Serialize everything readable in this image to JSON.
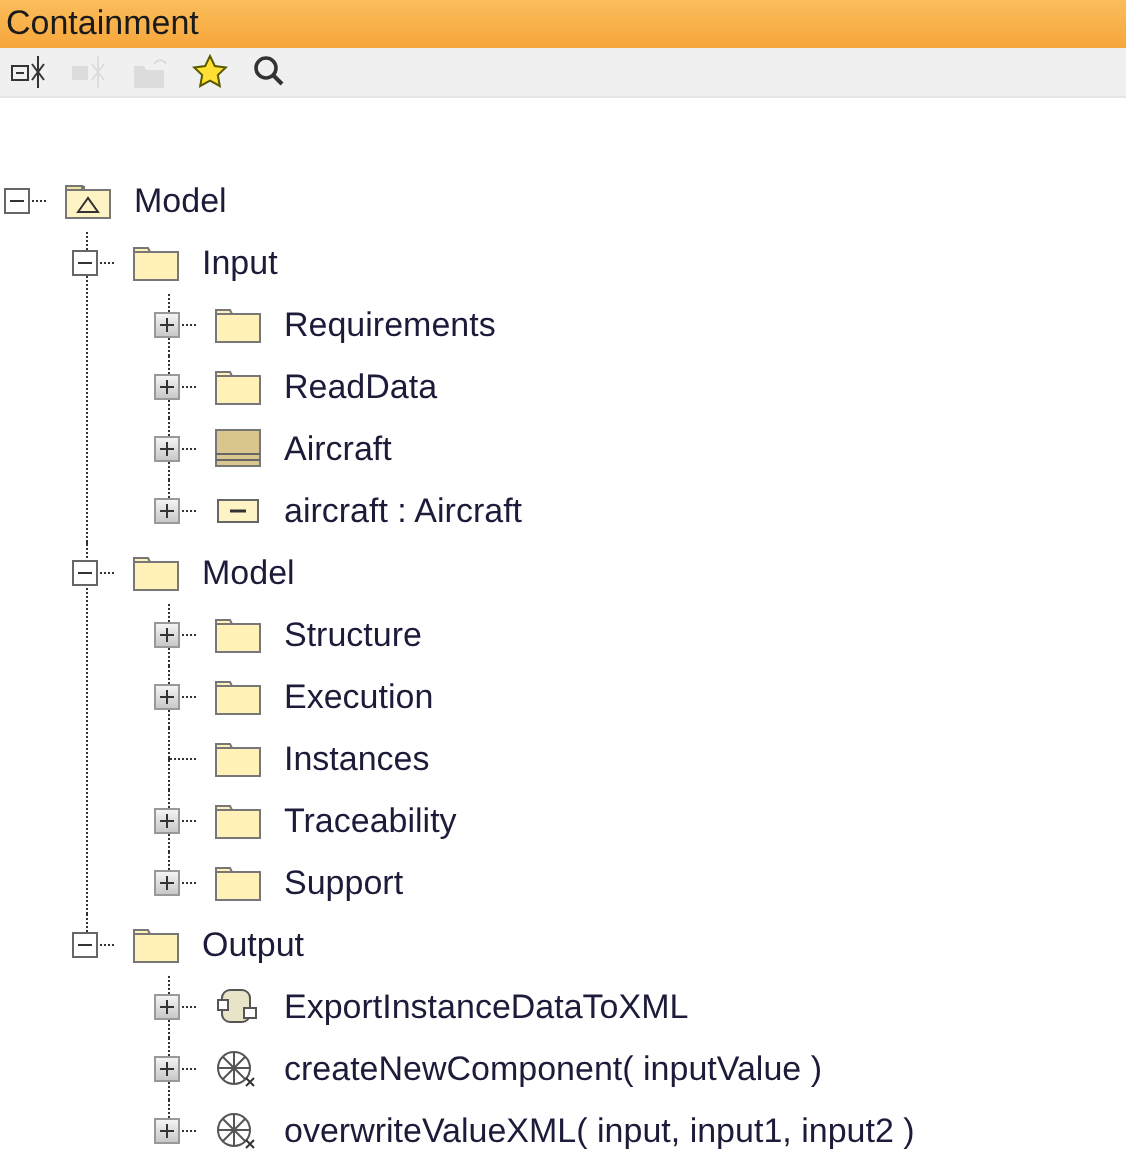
{
  "panel": {
    "title": "Containment"
  },
  "toolbar": [
    {
      "kind": "collapse",
      "disabled": false
    },
    {
      "kind": "expand",
      "disabled": true
    },
    {
      "kind": "folder",
      "disabled": true
    },
    {
      "kind": "star",
      "disabled": false
    },
    {
      "kind": "search",
      "disabled": false
    }
  ],
  "tree": [
    {
      "label": "Model",
      "kind": "model",
      "expandable": true,
      "expanded": true,
      "children": [
        {
          "label": "Input",
          "kind": "folder",
          "expandable": true,
          "expanded": true,
          "children": [
            {
              "label": "Requirements",
              "kind": "folder",
              "expandable": true,
              "expanded": false
            },
            {
              "label": "ReadData",
              "kind": "folder",
              "expandable": true,
              "expanded": false
            },
            {
              "label": "Aircraft",
              "kind": "block",
              "expandable": true,
              "expanded": false
            },
            {
              "label": "aircraft : Aircraft",
              "kind": "instance",
              "expandable": true,
              "expanded": false
            }
          ]
        },
        {
          "label": "Model",
          "kind": "folder",
          "expandable": true,
          "expanded": true,
          "children": [
            {
              "label": "Structure",
              "kind": "folder",
              "expandable": true,
              "expanded": false
            },
            {
              "label": "Execution",
              "kind": "folder",
              "expandable": true,
              "expanded": false
            },
            {
              "label": "Instances",
              "kind": "folder",
              "expandable": false
            },
            {
              "label": "Traceability",
              "kind": "folder",
              "expandable": true,
              "expanded": false
            },
            {
              "label": "Support",
              "kind": "folder",
              "expandable": true,
              "expanded": false
            }
          ]
        },
        {
          "label": "Output",
          "kind": "folder",
          "expandable": true,
          "expanded": true,
          "children": [
            {
              "label": "ExportInstanceDataToXML",
              "kind": "activity",
              "expandable": true,
              "expanded": false
            },
            {
              "label": "createNewComponent( inputValue )",
              "kind": "operation",
              "expandable": true,
              "expanded": false
            },
            {
              "label": "overwriteValueXML( input, input1, input2 )",
              "kind": "operation",
              "expandable": true,
              "expanded": false
            }
          ]
        }
      ]
    }
  ]
}
